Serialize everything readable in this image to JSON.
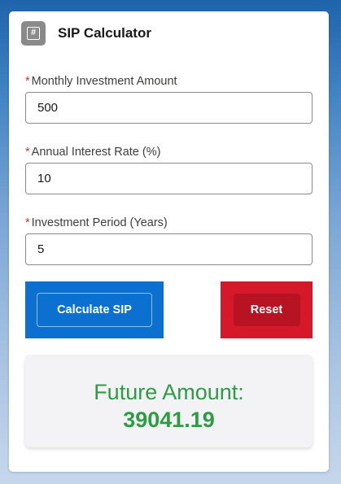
{
  "header": {
    "title": "SIP Calculator",
    "icon": "calculator-icon",
    "icon_glyph": "#"
  },
  "form": {
    "required_marker": "*",
    "monthly_investment": {
      "label": "Monthly Investment Amount",
      "value": "500"
    },
    "annual_rate": {
      "label": "Annual Interest Rate (%)",
      "value": "10"
    },
    "period_years": {
      "label": "Investment Period (Years)",
      "value": "5"
    }
  },
  "actions": {
    "calculate_label": "Calculate SIP",
    "reset_label": "Reset"
  },
  "result": {
    "label": "Future Amount:",
    "value": "39041.19"
  },
  "colors": {
    "brand_blue": "#0b70d0",
    "destructive_red": "#d5192b",
    "result_green": "#2e9b45",
    "required_red": "#c23934"
  }
}
